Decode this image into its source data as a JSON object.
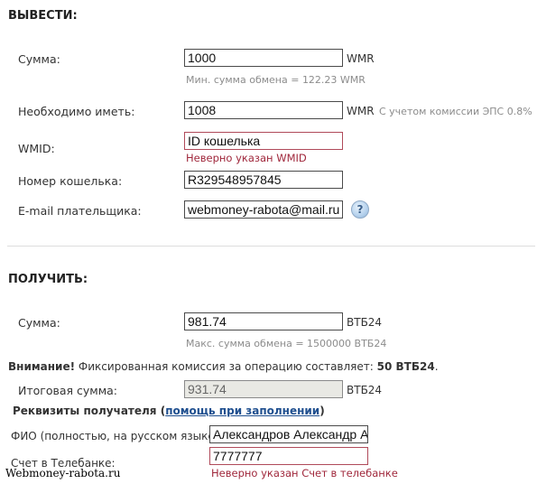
{
  "withdraw": {
    "title": "ВЫВЕСТИ:",
    "amount_label": "Сумма:",
    "amount_value": "1000",
    "amount_unit": "WMR",
    "amount_hint": "Мин. сумма обмена = 122.23 WMR",
    "required_label": "Необходимо иметь:",
    "required_value": "1008",
    "required_unit": "WMR",
    "required_note": "С учетом комиссии ЭПС 0.8%",
    "wmid_label": "WMID:",
    "wmid_value": "ID кошелька",
    "wmid_error": "Неверно указан WMID",
    "wallet_label": "Номер кошелька:",
    "wallet_value": "R329548957845",
    "email_label": "E-mail плательщика:",
    "email_value": "webmoney-rabota@mail.ru",
    "help_glyph": "?"
  },
  "receive": {
    "title": "ПОЛУЧИТЬ:",
    "amount_label": "Сумма:",
    "amount_value": "981.74",
    "amount_unit": "ВТБ24",
    "amount_hint": "Макс. сумма обмена = 1500000 ВТБ24",
    "notice_strong": "Внимание!",
    "notice_text": " Фиксированная комиссия за операцию составляет: ",
    "notice_amount": "50 ВТБ24",
    "notice_end": ".",
    "total_label": "Итоговая сумма:",
    "total_value": "931.74",
    "total_unit": "ВТБ24",
    "requisites_label": "Реквизиты получателя (",
    "requisites_link": "помощь при заполнении",
    "requisites_end": ")",
    "fio_label": "ФИО (полностью, на русском языке):",
    "fio_value": "Александров Александр Александрович",
    "account_label": "Счет в Телебанке:",
    "account_value": "7777777",
    "account_error": "Неверно указан Счет в телебанке"
  },
  "watermark": "Webmoney-rabota.ru",
  "colors": {
    "error": "#a0283c",
    "hint": "#8c8c8c",
    "link": "#1f4f8f",
    "readonly_bg": "#e9e9e4"
  }
}
